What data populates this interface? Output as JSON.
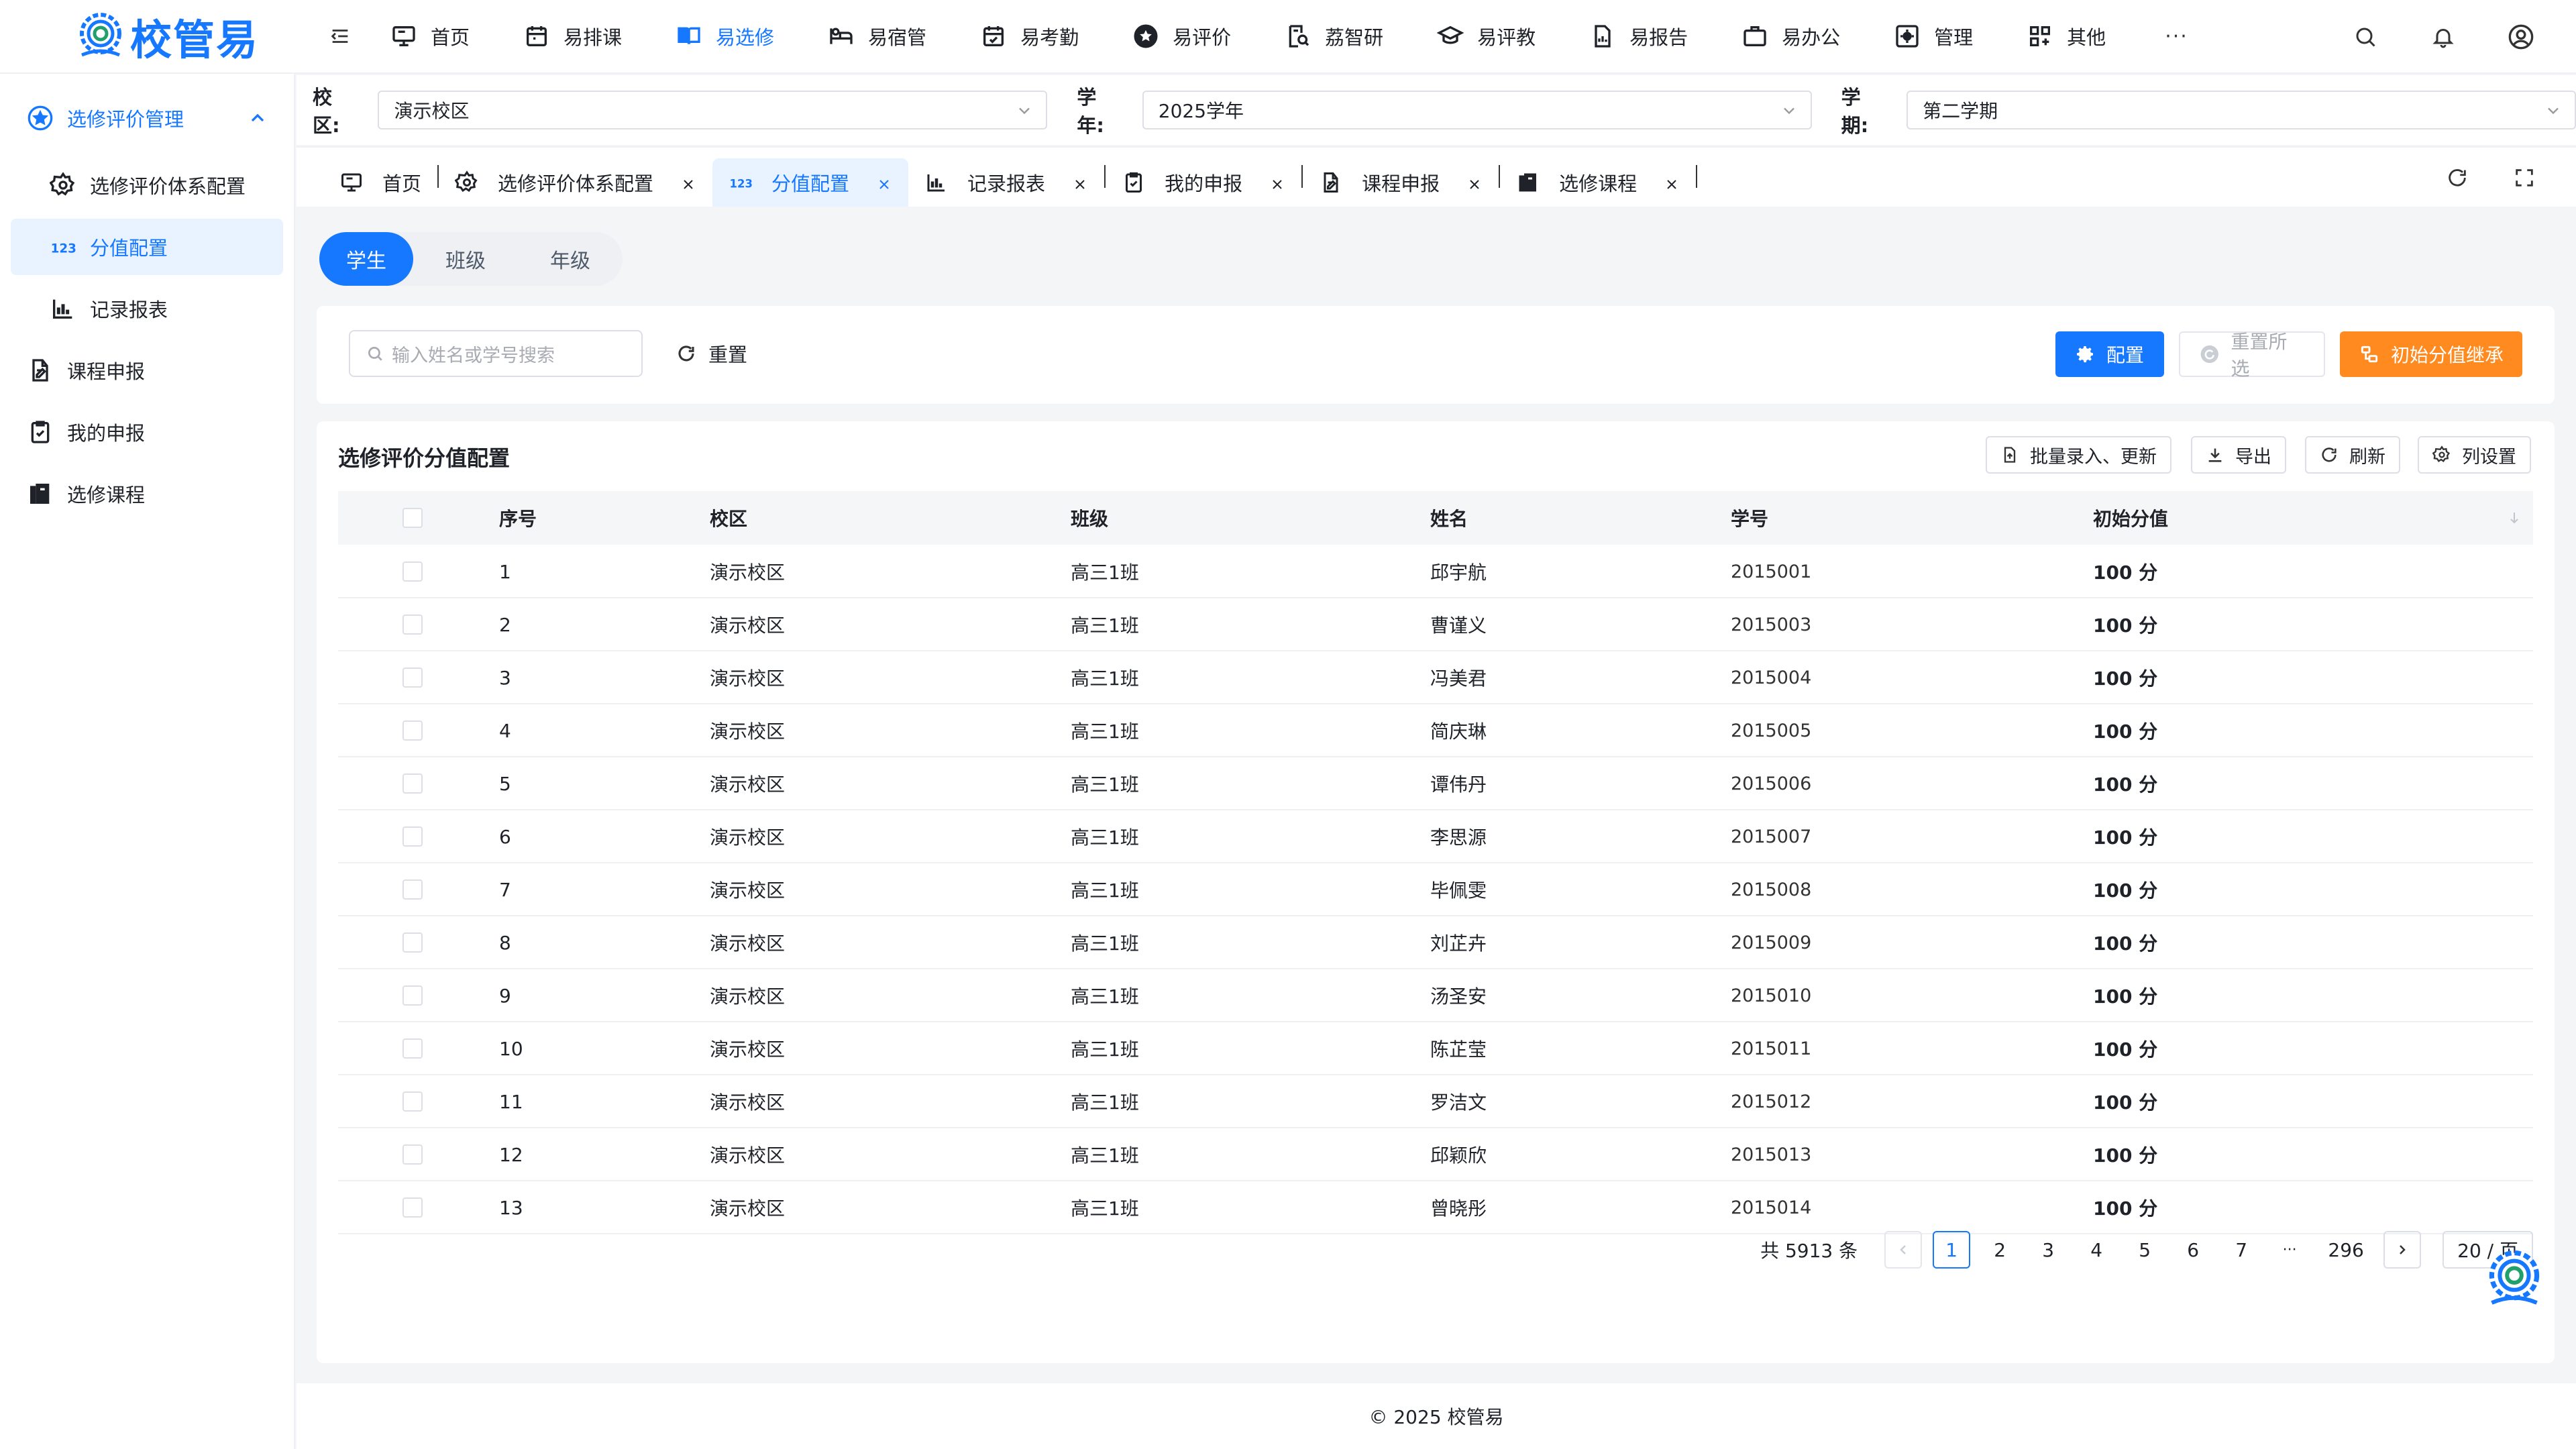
{
  "app": {
    "logo_text": "校管易"
  },
  "nav": [
    {
      "label": "首页",
      "icon": "monitor-icon"
    },
    {
      "label": "易排课",
      "icon": "calendar-icon"
    },
    {
      "label": "易选修",
      "icon": "book-icon",
      "active": true
    },
    {
      "label": "易宿管",
      "icon": "bed-icon"
    },
    {
      "label": "易考勤",
      "icon": "calendar-check-icon"
    },
    {
      "label": "易评价",
      "icon": "star-icon"
    },
    {
      "label": "荔智研",
      "icon": "research-icon"
    },
    {
      "label": "易评教",
      "icon": "graduation-cap-icon"
    },
    {
      "label": "易报告",
      "icon": "report-icon"
    },
    {
      "label": "易办公",
      "icon": "briefcase-icon"
    },
    {
      "label": "管理",
      "icon": "settings-box-icon"
    },
    {
      "label": "其他",
      "icon": "apps-icon"
    }
  ],
  "nav_more": "···",
  "sidebar": {
    "group": "选修评价管理",
    "items": [
      {
        "label": "选修评价体系配置",
        "icon": "gear-icon"
      },
      {
        "label": "分值配置",
        "icon": "numbers-icon",
        "active": true
      },
      {
        "label": "记录报表",
        "icon": "bar-chart-icon"
      }
    ],
    "top_items": [
      {
        "label": "课程申报",
        "icon": "edit-doc-icon"
      },
      {
        "label": "我的申报",
        "icon": "clipboard-check-icon"
      },
      {
        "label": "选修课程",
        "icon": "books-icon"
      }
    ]
  },
  "filters": {
    "campus_label": "校区:",
    "campus_value": "演示校区",
    "year_label": "学年:",
    "year_value": "2025学年",
    "term_label": "学期:",
    "term_value": "第二学期"
  },
  "tabs": [
    {
      "label": "首页",
      "icon": "monitor-icon",
      "closable": false
    },
    {
      "label": "选修评价体系配置",
      "icon": "gear-icon",
      "closable": true
    },
    {
      "label": "分值配置",
      "icon": "numbers-icon",
      "closable": true,
      "active": true
    },
    {
      "label": "记录报表",
      "icon": "bar-chart-icon",
      "closable": true
    },
    {
      "label": "我的申报",
      "icon": "clipboard-check-icon",
      "closable": true
    },
    {
      "label": "课程申报",
      "icon": "edit-doc-icon",
      "closable": true
    },
    {
      "label": "选修课程",
      "icon": "books-icon",
      "closable": true
    }
  ],
  "segments": [
    {
      "label": "学生",
      "active": true
    },
    {
      "label": "班级"
    },
    {
      "label": "年级"
    }
  ],
  "search": {
    "placeholder": "输入姓名或学号搜索",
    "reset_label": "重置",
    "config_label": "配置",
    "reset_selected_label": "重置所选",
    "inherit_label": "初始分值继承"
  },
  "table": {
    "title": "选修评价分值配置",
    "toolbar": {
      "batch_label": "批量录入、更新",
      "export_label": "导出",
      "refresh_label": "刷新",
      "columns_label": "列设置"
    },
    "columns": [
      "序号",
      "校区",
      "班级",
      "姓名",
      "学号",
      "初始分值"
    ],
    "rows": [
      {
        "no": "1",
        "campus": "演示校区",
        "class": "高三1班",
        "name": "邱宇航",
        "id": "2015001",
        "score": "100 分"
      },
      {
        "no": "2",
        "campus": "演示校区",
        "class": "高三1班",
        "name": "曹谨义",
        "id": "2015003",
        "score": "100 分"
      },
      {
        "no": "3",
        "campus": "演示校区",
        "class": "高三1班",
        "name": "冯美君",
        "id": "2015004",
        "score": "100 分"
      },
      {
        "no": "4",
        "campus": "演示校区",
        "class": "高三1班",
        "name": "简庆琳",
        "id": "2015005",
        "score": "100 分"
      },
      {
        "no": "5",
        "campus": "演示校区",
        "class": "高三1班",
        "name": "谭伟丹",
        "id": "2015006",
        "score": "100 分"
      },
      {
        "no": "6",
        "campus": "演示校区",
        "class": "高三1班",
        "name": "李思源",
        "id": "2015007",
        "score": "100 分"
      },
      {
        "no": "7",
        "campus": "演示校区",
        "class": "高三1班",
        "name": "毕佩雯",
        "id": "2015008",
        "score": "100 分"
      },
      {
        "no": "8",
        "campus": "演示校区",
        "class": "高三1班",
        "name": "刘芷卉",
        "id": "2015009",
        "score": "100 分"
      },
      {
        "no": "9",
        "campus": "演示校区",
        "class": "高三1班",
        "name": "汤圣安",
        "id": "2015010",
        "score": "100 分"
      },
      {
        "no": "10",
        "campus": "演示校区",
        "class": "高三1班",
        "name": "陈芷莹",
        "id": "2015011",
        "score": "100 分"
      },
      {
        "no": "11",
        "campus": "演示校区",
        "class": "高三1班",
        "name": "罗洁文",
        "id": "2015012",
        "score": "100 分"
      },
      {
        "no": "12",
        "campus": "演示校区",
        "class": "高三1班",
        "name": "邱颖欣",
        "id": "2015013",
        "score": "100 分"
      },
      {
        "no": "13",
        "campus": "演示校区",
        "class": "高三1班",
        "name": "曾晓彤",
        "id": "2015014",
        "score": "100 分"
      }
    ]
  },
  "pagination": {
    "total": "共 5913 条",
    "pages": [
      "1",
      "2",
      "3",
      "4",
      "5",
      "6",
      "7",
      "···",
      "296"
    ],
    "current": "1",
    "page_size": "20 / 页"
  },
  "footer": "© 2025 校管易",
  "colors": {
    "primary": "#1677ff",
    "orange": "#ff8a1f",
    "active_bg": "#e8f3ff"
  }
}
